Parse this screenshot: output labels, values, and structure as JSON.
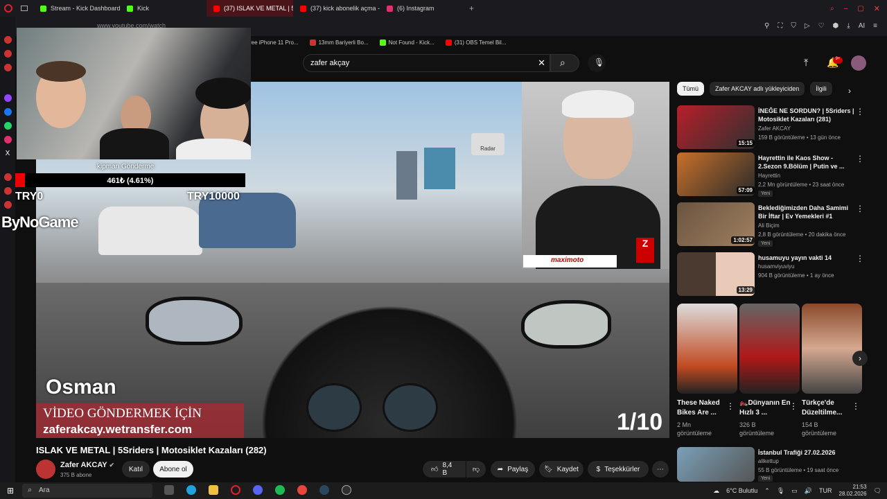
{
  "browser": {
    "tabs": [
      {
        "label": "Stream - Kick Dashboard",
        "color": "#53fc18"
      },
      {
        "label": "Kick",
        "color": "#53fc18"
      },
      {
        "label": "(37) ISLAK VE METAL | 5S",
        "color": "#ff0000",
        "active": true
      },
      {
        "label": "(37) kick abonelik açma -",
        "color": "#ff0000"
      },
      {
        "label": "(6) Instagram",
        "color": "#e1306c"
      }
    ],
    "url": "www.youtube.com/watch"
  },
  "bookmarks": [
    "ree iPhone 11 Pro...",
    "13mm Bariyerli Bo...",
    "Not Found - Kick...",
    "(31) OBS Temel Bil..."
  ],
  "search": {
    "value": "zafer akçay"
  },
  "overlay": {
    "donation": "461₺ (4.61%)",
    "donation_label": "kipman Gönderme",
    "goal_start": "TRY0",
    "goal_end": "TRY10000",
    "brand": "ByNoGame"
  },
  "video": {
    "caption_name": "Osman",
    "promo_line1": "VİDEO GÖNDERMEK İÇİN",
    "promo_line2": "zaferakcay.wetransfer.com",
    "counter": "1/10",
    "sign": "Radar",
    "inset_logo": "maximoto"
  },
  "meta": {
    "title": "ISLAK VE METAL | 5Sriders | Motosiklet Kazaları (282)",
    "channel": "Zafer AKCAY",
    "subscribers": "375 B abone",
    "join": "Katıl",
    "subscribe": "Abone ol",
    "likes": "8,4 B",
    "share": "Paylaş",
    "save": "Kaydet",
    "thanks": "Teşekkürler"
  },
  "chips": [
    "Tümü",
    "Zafer AKCAY adlı yükleyiciden",
    "İlgili"
  ],
  "recommendations": [
    {
      "title": "İNEĞE NE SORDUN? | 5Sriders | Motosiklet Kazaları (281)",
      "channel": "Zafer AKCAY",
      "meta": "159 B görüntüleme • 13 gün önce",
      "duration": "15:15",
      "badge": "",
      "color": "#b81f2a"
    },
    {
      "title": "Hayrettin ile Kaos Show - 2.Sezon 9.Bölüm | Putin ve ...",
      "channel": "Hayrettin",
      "meta": "2,2 Mn görüntüleme • 23 saat önce",
      "duration": "57:09",
      "badge": "Yeni",
      "color": "#c8702a"
    },
    {
      "title": "Beklediğimizden Daha Samimi Bir İftar | Ev Yemekleri #1",
      "channel": "Ali Biçim",
      "meta": "2,8 B görüntüleme • 20 dakika önce",
      "duration": "1:02:57",
      "badge": "Yeni",
      "color": "#6a5440"
    },
    {
      "title": "husamuyu yayın vakti 14",
      "channel": "husamviyuviyu",
      "meta": "904 B görüntüleme • 1 ay önce",
      "duration": "13:29",
      "badge": "",
      "color": "#8a6a5a"
    }
  ],
  "shorts": [
    {
      "title": "These Naked Bikes Are ...",
      "views": "2 Mn görüntüleme",
      "color": "#c9c9c9"
    },
    {
      "title": "🏍️Dünyanın En Hızlı 3 ...",
      "views": "326 B görüntüleme",
      "color": "#555"
    },
    {
      "title": "Türkçe'de Düzeltilme...",
      "views": "154 B görüntüleme",
      "color": "#a05a3a"
    }
  ],
  "next": {
    "title": "İstanbul Trafiği 27.02.2026",
    "channel": "alikettup",
    "meta": "55 B görüntüleme • 19 saat önce",
    "badge": "Yeni"
  },
  "taskbar": {
    "search": "Ara",
    "weather": "6°C Bulutlu",
    "lang": "TUR",
    "time": "21:53",
    "date": "28.02.2026"
  }
}
